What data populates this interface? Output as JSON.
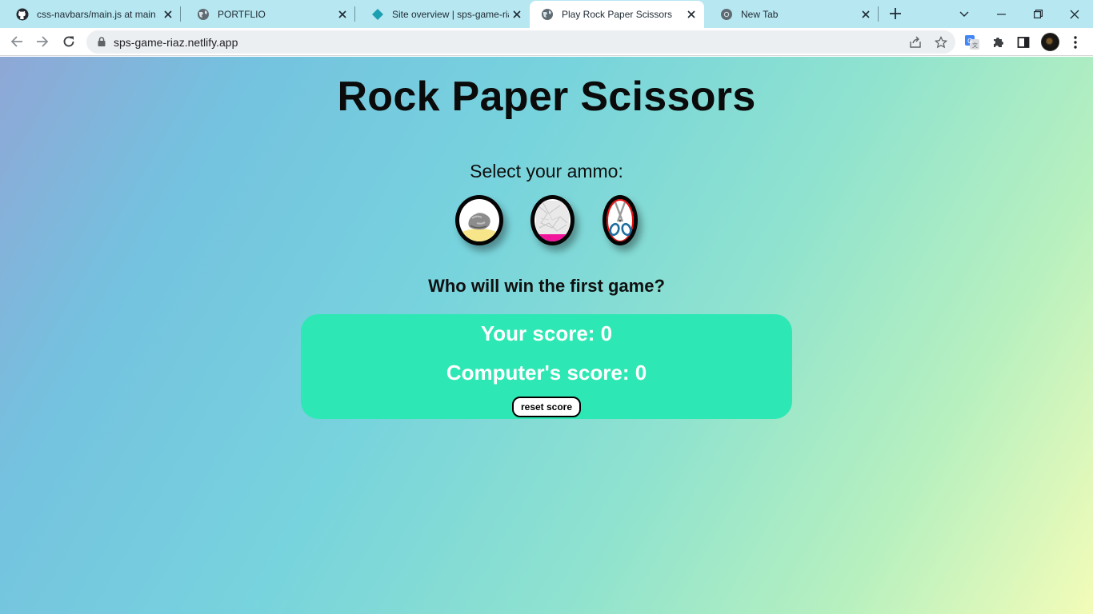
{
  "browser": {
    "tabs": [
      {
        "title": "css-navbars/main.js at main",
        "icon": "github-icon"
      },
      {
        "title": "PORTFLIO",
        "icon": "globe-icon"
      },
      {
        "title": "Site overview | sps-game-riaz",
        "icon": "netlify-icon"
      },
      {
        "title": "Play Rock Paper Scissors",
        "icon": "globe-icon",
        "active": true
      },
      {
        "title": "New Tab",
        "icon": "chrome-icon"
      }
    ],
    "url": "sps-game-riaz.netlify.app",
    "accent_color": "#b7e7f1"
  },
  "page": {
    "title": "Rock Paper Scissors",
    "select_label": "Select your ammo:",
    "ammo": [
      {
        "name": "rock",
        "ring_color": "#f7e58a"
      },
      {
        "name": "paper",
        "ring_color": "#f0159a"
      },
      {
        "name": "scissors",
        "ring_color": "#e60d0d"
      }
    ],
    "question": "Who will win the first game?",
    "your_score": "Your score: 0",
    "computer_score": "Computer's score: 0",
    "reset_label": "reset score",
    "score_box_color": "#2de8b4"
  }
}
